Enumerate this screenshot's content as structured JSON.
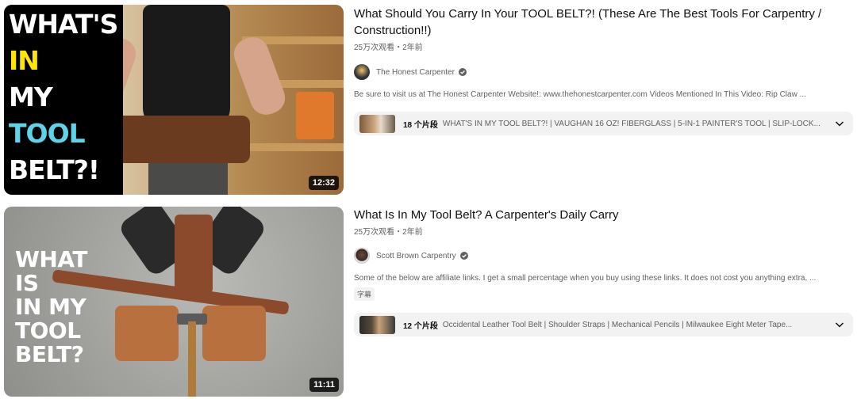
{
  "results": [
    {
      "thumbnail_text": [
        "WHAT'S",
        "IN",
        "MY",
        "TOOL",
        "BELT?!"
      ],
      "thumbnail_text_colors": [
        "#ffffff",
        "#ffe600",
        "#ffffff",
        "#5fd3e8",
        "#ffffff"
      ],
      "duration": "12:32",
      "title": "What Should You Carry In Your TOOL BELT?! (These Are The Best Tools For Carpentry / Construction!!)",
      "meta": "25万次观看・2年前",
      "channel": "The Honest Carpenter",
      "verified_icon": "verified-check-icon",
      "description": "Be sure to visit us at The Honest Carpenter Website!: www.thehonestcarpenter.com Videos Mentioned In This Video: Rip Claw ...",
      "chapters_count": "18 个片段",
      "chapters_list": "WHAT'S IN MY TOOL BELT?! | VAUGHAN 16 OZ! FIBERGLASS | 5-IN-1 PAINTER'S TOOL | SLIP-LOCK..."
    },
    {
      "thumbnail_text": [
        "WHAT",
        "IS",
        "IN MY",
        "TOOL",
        "BELT?"
      ],
      "duration": "11:11",
      "title": "What Is In My Tool Belt? A Carpenter's Daily Carry",
      "meta": "25万次观看・2年前",
      "channel": "Scott Brown Carpentry",
      "verified_icon": "verified-check-icon",
      "description": "Some of the below are affiliate links. I get a small percentage when you buy using these links. It does not cost you anything extra, ...",
      "badge": "字幕",
      "chapters_count": "12 个片段",
      "chapters_list": "Occidental Leather Tool Belt | Shoulder Straps | Mechanical Pencils | Milwaukee Eight Meter Tape..."
    }
  ],
  "colors": {
    "text_primary": "#0f0f0f",
    "text_secondary": "#606060",
    "chapter_bg": "#f2f2f2"
  }
}
